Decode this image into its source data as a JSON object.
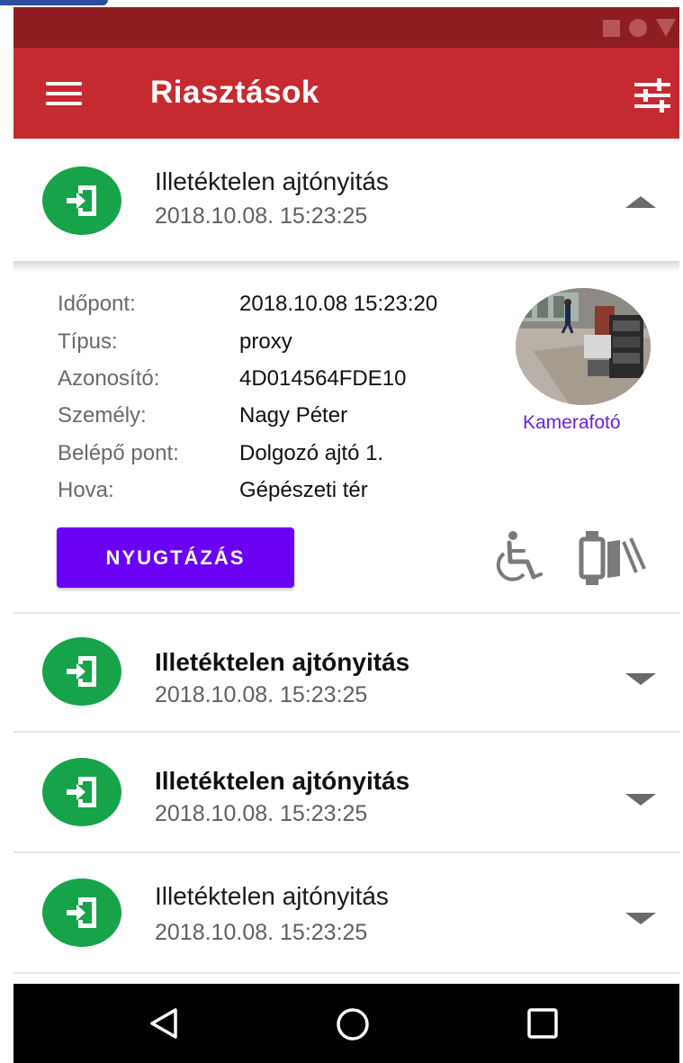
{
  "app": {
    "title": "Riasztások",
    "colors": {
      "appbar": "#c62a31",
      "statusbar": "#8e1d22",
      "accent": "#6a00f4",
      "avatar": "#16a34a",
      "link": "#6d1fe0"
    }
  },
  "toolbar": {
    "menu_icon": "hamburger-menu-icon",
    "filter_icon": "tune-sliders-icon"
  },
  "alerts": [
    {
      "title": "Illetéktelen ajtónyitás",
      "time": "2018.10.08.  15:23:25",
      "expanded": true,
      "unread": false,
      "icon": "door-entry-icon"
    },
    {
      "title": "Illetéktelen ajtónyitás",
      "time": "2018.10.08.  15:23:25",
      "expanded": false,
      "unread": true,
      "icon": "door-entry-icon"
    },
    {
      "title": "Illetéktelen ajtónyitás",
      "time": "2018.10.08.  15:23:25",
      "expanded": false,
      "unread": true,
      "icon": "door-entry-icon"
    },
    {
      "title": "Illetéktelen ajtónyitás",
      "time": "2018.10.08.  15:23:25",
      "expanded": false,
      "unread": false,
      "icon": "door-entry-icon"
    }
  ],
  "detail": {
    "fields": [
      {
        "label": "Időpont:",
        "value": "2018.10.08  15:23:20"
      },
      {
        "label": "Típus:",
        "value": "proxy"
      },
      {
        "label": "Azonosító:",
        "value": "4D014564FDE10"
      },
      {
        "label": "Személy:",
        "value": "Nagy Péter"
      },
      {
        "label": "Belépő pont:",
        "value": "Dolgozó ajtó 1."
      },
      {
        "label": "Hova:",
        "value": "Gépészeti tér"
      }
    ],
    "camera_label": "Kamerafotó",
    "ack_label": "NYUGTÁZÁS",
    "icons": [
      "wheelchair-icon",
      "access-card-icon"
    ]
  },
  "navbar": {
    "icons": [
      "back-icon",
      "home-icon",
      "recents-icon"
    ]
  }
}
